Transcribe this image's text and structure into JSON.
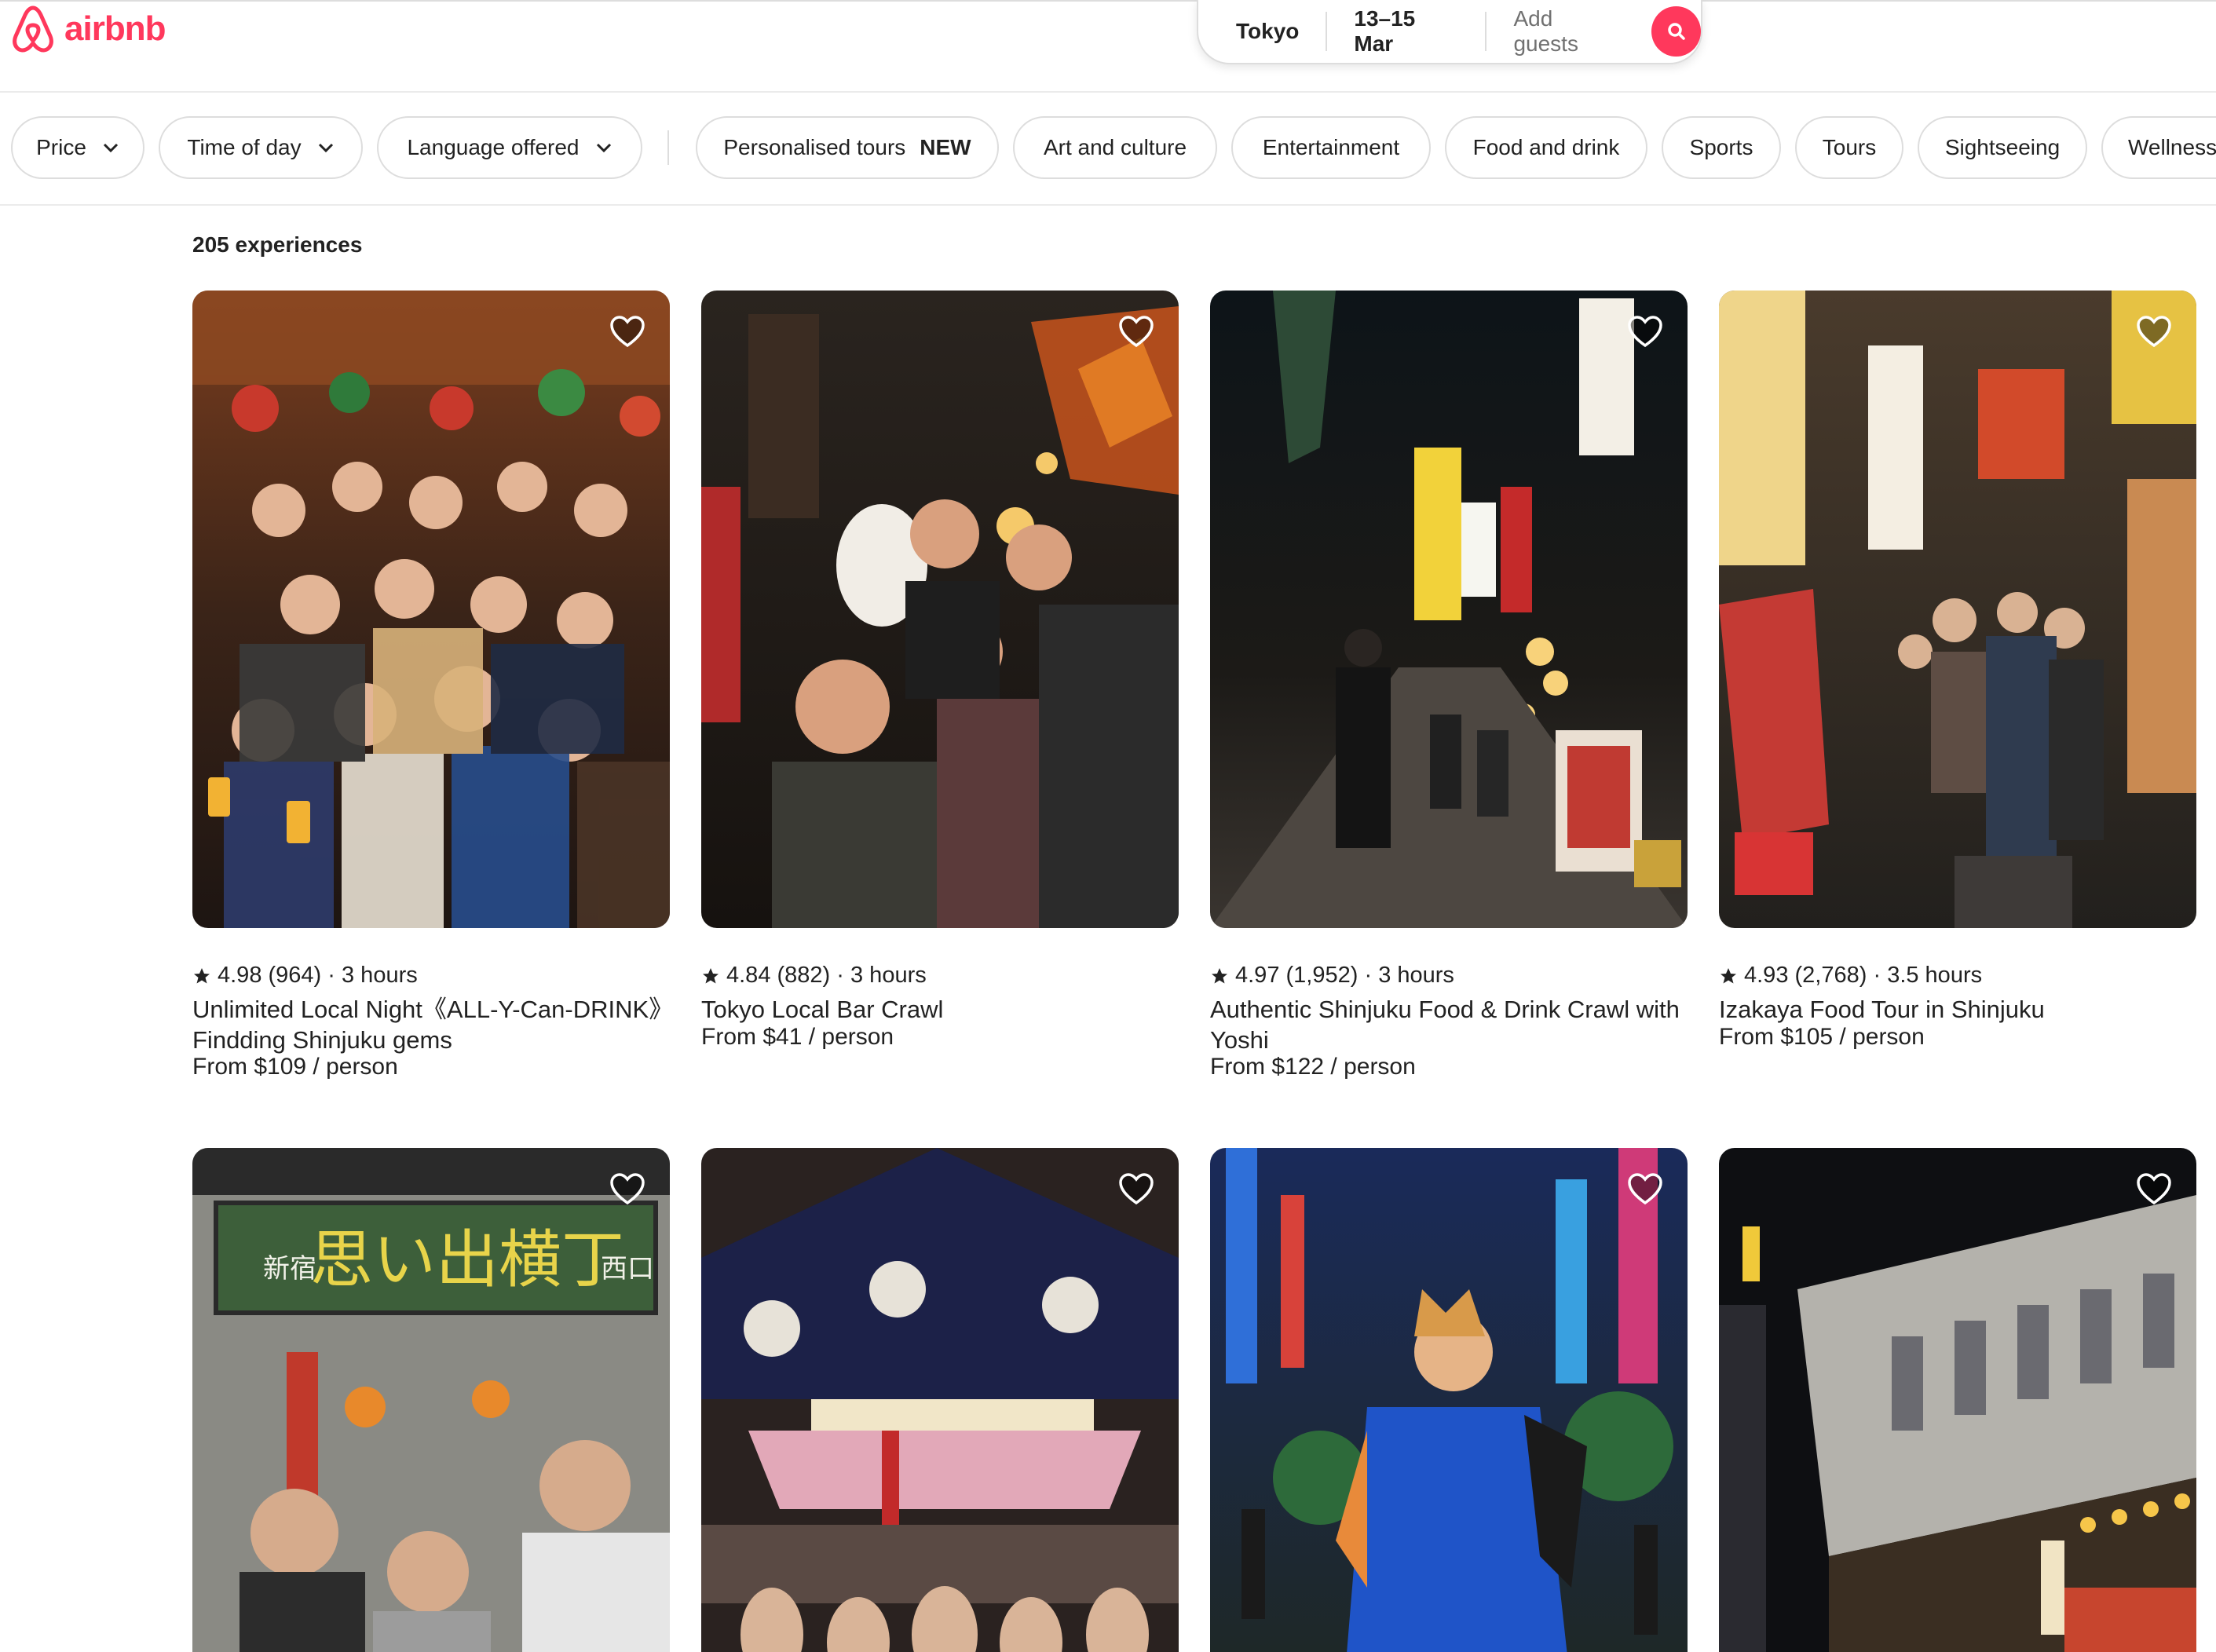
{
  "brand": {
    "name": "airbnb",
    "color": "#ff385c"
  },
  "search": {
    "location": "Tokyo",
    "dates": "13–15 Mar",
    "guests_placeholder": "Add guests",
    "icon": "search-icon"
  },
  "filters": {
    "dropdowns": [
      "Price",
      "Time of day",
      "Language offered"
    ],
    "personalised": {
      "label": "Personalised tours",
      "badge": "NEW"
    },
    "categories": [
      "Art and culture",
      "Entertainment",
      "Food and drink",
      "Sports",
      "Tours",
      "Sightseeing",
      "Wellness"
    ]
  },
  "results": {
    "count_label": "205 experiences",
    "listings": [
      {
        "rating": "4.98",
        "reviews": "(964)",
        "duration": "3 hours",
        "title": "Unlimited Local Night《ALL-Y-Can-DRINK》Findding Shinjuku gems",
        "price": "From $109 / person"
      },
      {
        "rating": "4.84",
        "reviews": "(882)",
        "duration": "3 hours",
        "title": "Tokyo Local Bar Crawl",
        "price": "From $41 / person"
      },
      {
        "rating": "4.97",
        "reviews": "(1,952)",
        "duration": "3 hours",
        "title": "Authentic Shinjuku Food & Drink Crawl with Yoshi",
        "price": "From $122 / person"
      },
      {
        "rating": "4.93",
        "reviews": "(2,768)",
        "duration": "3.5 hours",
        "title": "Izakaya Food Tour in Shinjuku",
        "price": "From $105 / person"
      }
    ],
    "photo_signs": [
      "思い出横丁",
      "新宿",
      "西口"
    ]
  }
}
